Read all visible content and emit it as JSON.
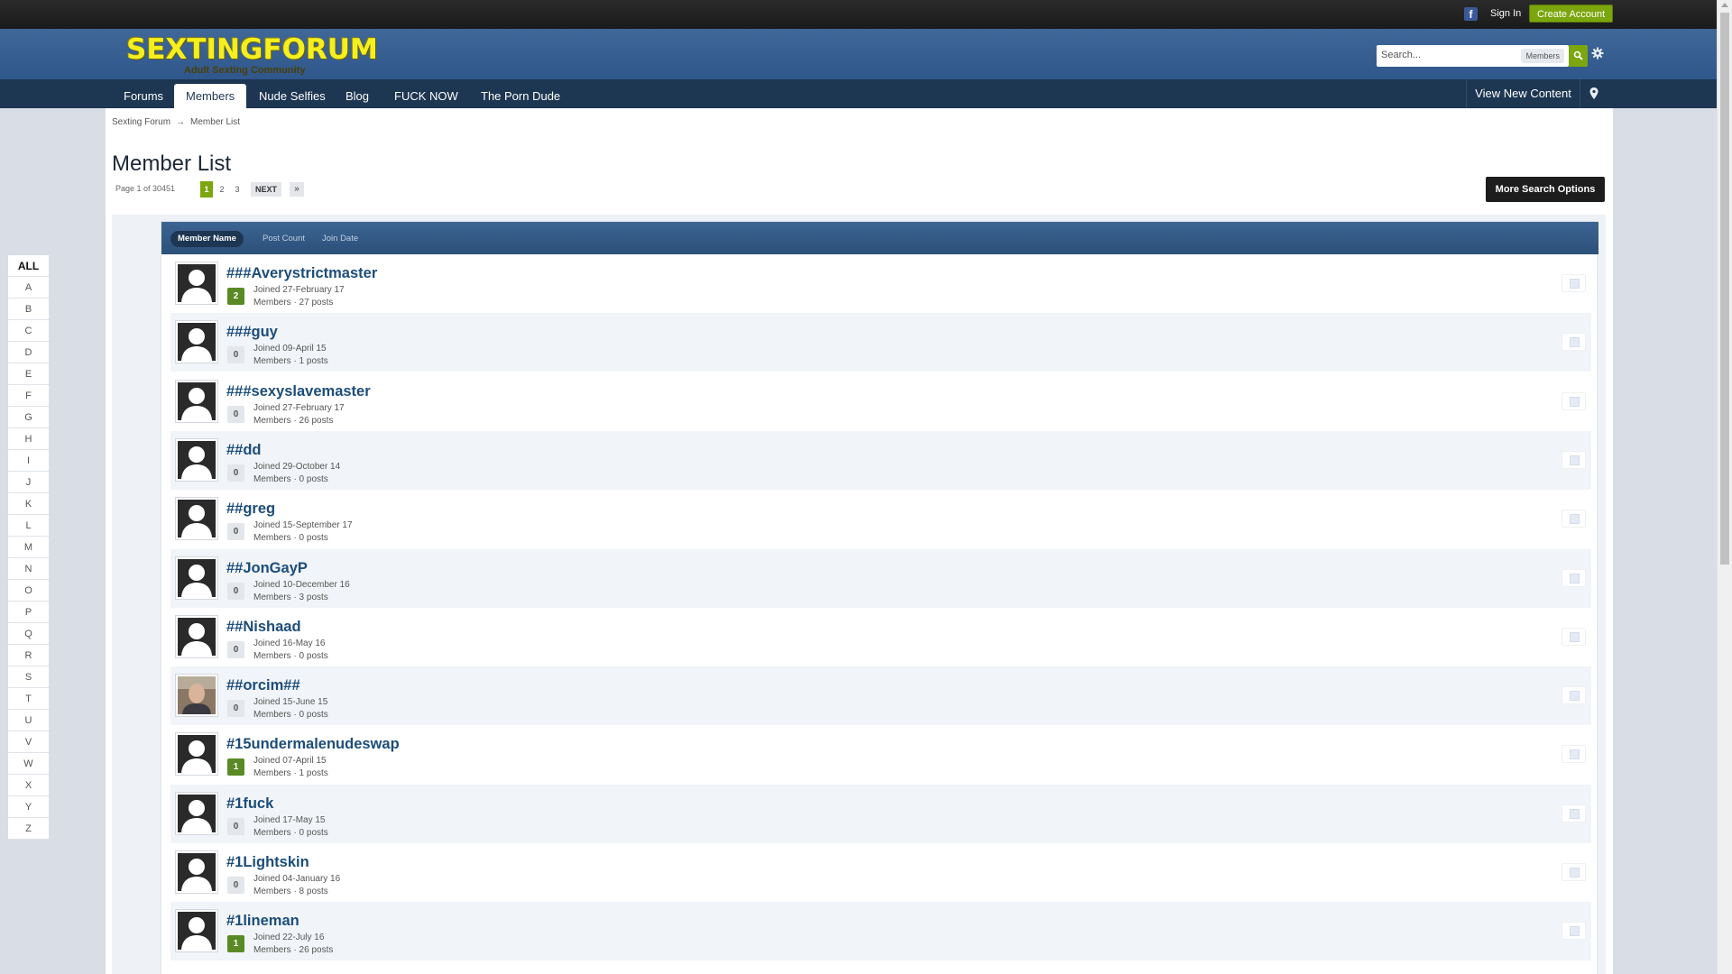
{
  "topbar": {
    "facebook_icon": "facebook-icon",
    "sign_in": "Sign In",
    "create_account": "Create Account"
  },
  "branding": {
    "logo_text": "SEXTINGFORUM",
    "logo_tagline": "Adult Sexting Community",
    "logo_color": "#f4ef1e"
  },
  "search": {
    "placeholder": "Search...",
    "scope": "Members",
    "search_icon": "search-icon",
    "settings_icon": "gear-icon"
  },
  "nav": {
    "tabs": [
      {
        "label": "Forums",
        "active": false
      },
      {
        "label": "Members",
        "active": true
      },
      {
        "label": "Nude Selfies",
        "active": false
      },
      {
        "label": "Blog",
        "active": false
      },
      {
        "label": "FUCK NOW",
        "active": false
      },
      {
        "label": "The Porn Dude",
        "active": false
      }
    ],
    "view_new_content": "View New Content",
    "pin_icon": "map-pin-icon"
  },
  "breadcrumb": {
    "home": "Sexting Forum",
    "separator": "→",
    "current": "Member List"
  },
  "page": {
    "title": "Member List",
    "page_info": "Page 1 of 30451",
    "pages": [
      "1",
      "2",
      "3"
    ],
    "current_page": "1",
    "next_label": "NEXT",
    "last_label": "»",
    "more_search_options": "More Search Options"
  },
  "letters": [
    "ALL",
    "A",
    "B",
    "C",
    "D",
    "E",
    "F",
    "G",
    "H",
    "I",
    "J",
    "K",
    "L",
    "M",
    "N",
    "O",
    "P",
    "Q",
    "R",
    "S",
    "T",
    "U",
    "V",
    "W",
    "X",
    "Y",
    "Z"
  ],
  "active_letter": "ALL",
  "sort": {
    "options": [
      "Member Name",
      "Post Count",
      "Join Date"
    ],
    "active": "Member Name"
  },
  "members": [
    {
      "name": "###Averystrictmaster",
      "rep": "2",
      "joined": "Joined 27-February 17",
      "group_posts": "Members · 27 posts",
      "positive": true,
      "photo": false
    },
    {
      "name": "###guy",
      "rep": "0",
      "joined": "Joined 09-April 15",
      "group_posts": "Members · 1 posts",
      "positive": false,
      "photo": false
    },
    {
      "name": "###sexyslavemaster",
      "rep": "0",
      "joined": "Joined 27-February 17",
      "group_posts": "Members · 26 posts",
      "positive": false,
      "photo": false
    },
    {
      "name": "##dd",
      "rep": "0",
      "joined": "Joined 29-October 14",
      "group_posts": "Members · 0 posts",
      "positive": false,
      "photo": false
    },
    {
      "name": "##greg",
      "rep": "0",
      "joined": "Joined 15-September 17",
      "group_posts": "Members · 0 posts",
      "positive": false,
      "photo": false
    },
    {
      "name": "##JonGayP",
      "rep": "0",
      "joined": "Joined 10-December 16",
      "group_posts": "Members · 3 posts",
      "positive": false,
      "photo": false
    },
    {
      "name": "##Nishaad",
      "rep": "0",
      "joined": "Joined 16-May 16",
      "group_posts": "Members · 0 posts",
      "positive": false,
      "photo": false
    },
    {
      "name": "##orcim##",
      "rep": "0",
      "joined": "Joined 15-June 15",
      "group_posts": "Members · 0 posts",
      "positive": false,
      "photo": true
    },
    {
      "name": "#15undermalenudeswap",
      "rep": "1",
      "joined": "Joined 07-April 15",
      "group_posts": "Members · 1 posts",
      "positive": true,
      "photo": false
    },
    {
      "name": "#1fuck",
      "rep": "0",
      "joined": "Joined 17-May 15",
      "group_posts": "Members · 0 posts",
      "positive": false,
      "photo": false
    },
    {
      "name": "#1Lightskin",
      "rep": "0",
      "joined": "Joined 04-January 16",
      "group_posts": "Members · 8 posts",
      "positive": false,
      "photo": false
    },
    {
      "name": "#1lineman",
      "rep": "1",
      "joined": "Joined 22-July 16",
      "group_posts": "Members · 26 posts",
      "positive": true,
      "photo": false
    }
  ],
  "colors": {
    "accent_green": "#7ba60d",
    "nav_dark": "#1d3652",
    "header_blue": "#2f578c",
    "link_blue": "#1c4d7a"
  }
}
